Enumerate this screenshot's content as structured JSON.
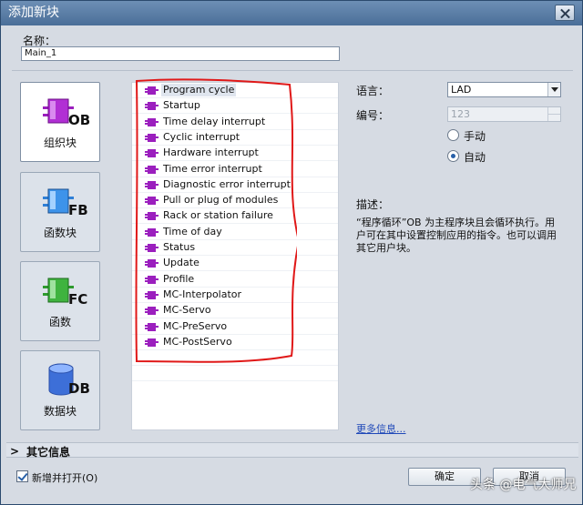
{
  "window": {
    "title": "添加新块"
  },
  "name": {
    "label": "名称：",
    "value": "Main_1"
  },
  "categories": [
    {
      "label": "组织块",
      "badge": "OB",
      "color": "#9b1fbe"
    },
    {
      "label": "函数块",
      "badge": "FB",
      "color": "#2f7fd6"
    },
    {
      "label": "函数",
      "badge": "FC",
      "color": "#2d9a2d"
    },
    {
      "label": "数据块",
      "badge": "DB",
      "color": "#3d6fd8"
    }
  ],
  "ob_list": [
    "Program cycle",
    "Startup",
    "Time delay interrupt",
    "Cyclic interrupt",
    "Hardware interrupt",
    "Time error interrupt",
    "Diagnostic error interrupt",
    "Pull or plug of modules",
    "Rack or station failure",
    "Time of day",
    "Status",
    "Update",
    "Profile",
    "MC-Interpolator",
    "MC-Servo",
    "MC-PreServo",
    "MC-PostServo"
  ],
  "language": {
    "label": "语言：",
    "value": "LAD"
  },
  "number": {
    "label": "编号：",
    "value": "123"
  },
  "numbering": {
    "manual": "手动",
    "auto": "自动",
    "selected": "auto"
  },
  "description": {
    "label": "描述：",
    "text": "“程序循环”OB 为主程序块且会循环执行。用户可在其中设置控制应用的指令。也可以调用其它用户块。"
  },
  "more_info": "更多信息...",
  "other_info": "其它信息",
  "add_and_open": "新增并打开(O)",
  "ok": "确定",
  "cancel": "取消",
  "watermark": "头条 @电气大师兄",
  "colors": {
    "ob_icon": "#9b1fbe",
    "highlight_outline": "#e01818",
    "link": "#1f48b8"
  }
}
